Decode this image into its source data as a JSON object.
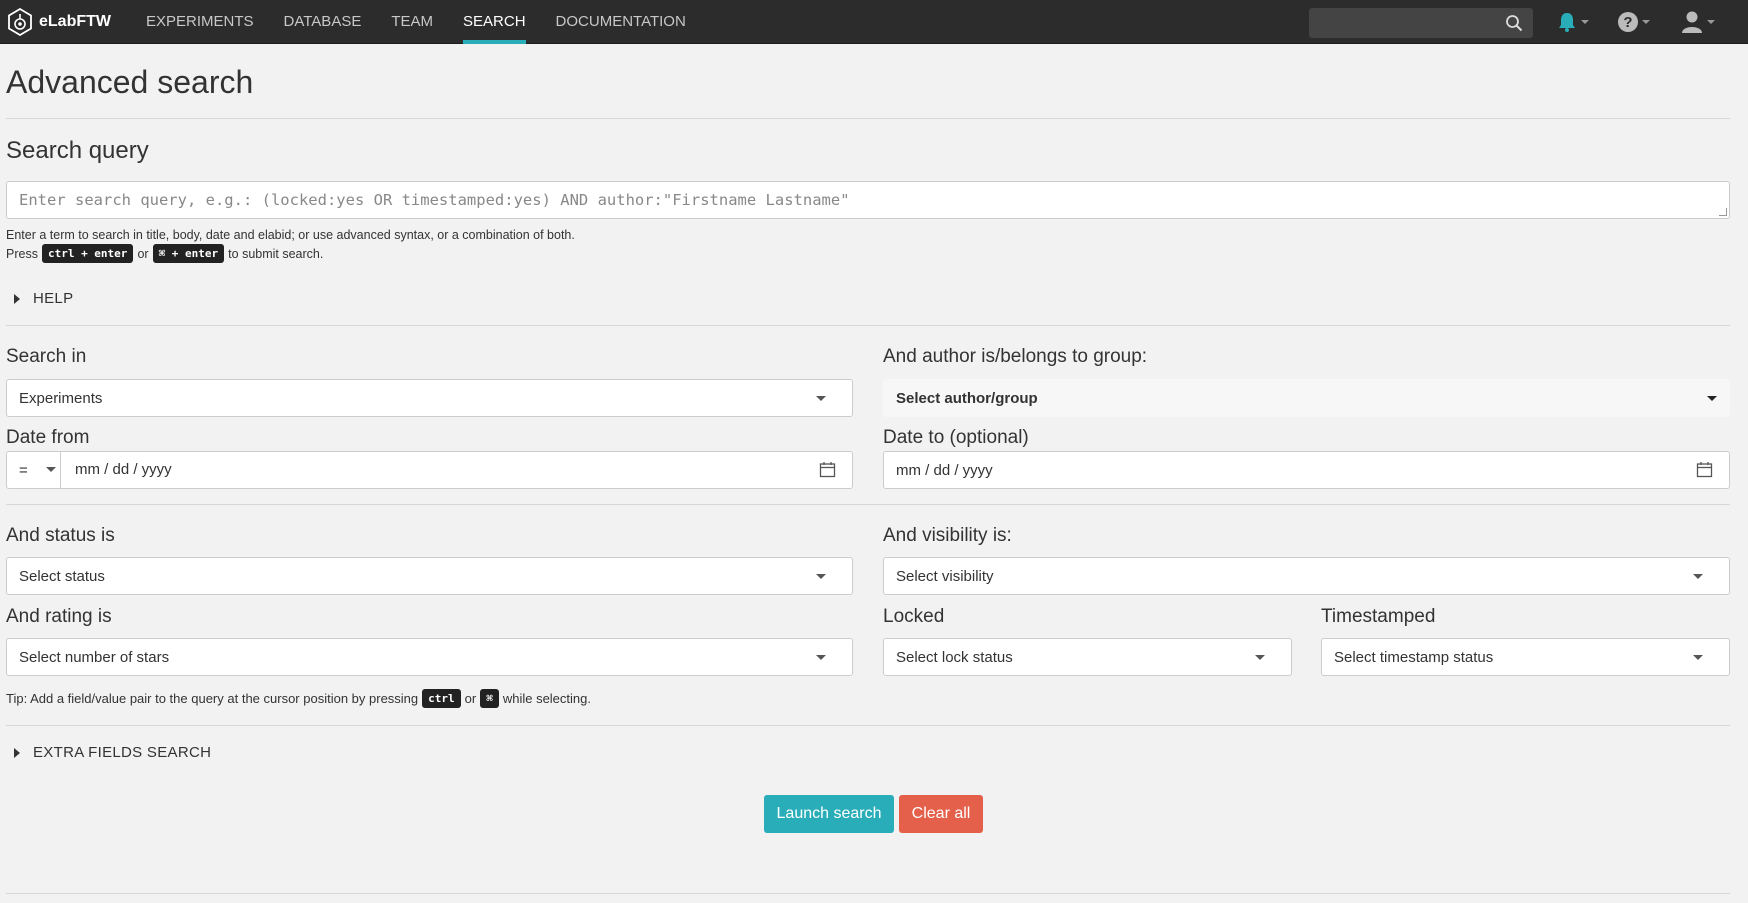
{
  "nav": {
    "brand": "eLabFTW",
    "links": [
      "EXPERIMENTS",
      "DATABASE",
      "TEAM",
      "SEARCH",
      "DOCUMENTATION"
    ],
    "active": "SEARCH",
    "search_placeholder": ""
  },
  "page_title": "Advanced search",
  "query": {
    "title": "Search query",
    "placeholder": "Enter search query, e.g.: (locked:yes OR timestamped:yes) AND author:\"Firstname Lastname\"",
    "hint_line1": "Enter a term to search in title, body, date and elabid; or use advanced syntax, or a combination of both.",
    "hint_press": "Press",
    "hint_key1": "ctrl + enter",
    "hint_or": "or",
    "hint_key2": "⌘ + enter",
    "hint_submit": "to submit search."
  },
  "help_label": "HELP",
  "filters": {
    "search_in_label": "Search in",
    "search_in_value": "Experiments",
    "author_label": "And author is/belongs to group:",
    "author_value": "Select author/group",
    "date_from_label": "Date from",
    "date_op": "=",
    "date_from_value": "mm / dd / yyyy",
    "date_to_label": "Date to (optional)",
    "date_to_value": "mm / dd / yyyy",
    "status_label": "And status is",
    "status_value": "Select status",
    "visibility_label": "And visibility is:",
    "visibility_value": "Select visibility",
    "rating_label": "And rating is",
    "rating_value": "Select number of stars",
    "locked_label": "Locked",
    "locked_value": "Select lock status",
    "timestamped_label": "Timestamped",
    "timestamped_value": "Select timestamp status"
  },
  "tip": {
    "prefix": "Tip: Add a field/value pair to the query at the cursor position by pressing",
    "key1": "ctrl",
    "or": "or",
    "key2": "⌘",
    "suffix": "while selecting."
  },
  "extra_fields_label": "EXTRA FIELDS SEARCH",
  "buttons": {
    "launch": "Launch search",
    "clear": "Clear all"
  },
  "colors": {
    "accent": "#29aeb9",
    "danger": "#e4604a",
    "navbar": "#2c2c2c"
  }
}
